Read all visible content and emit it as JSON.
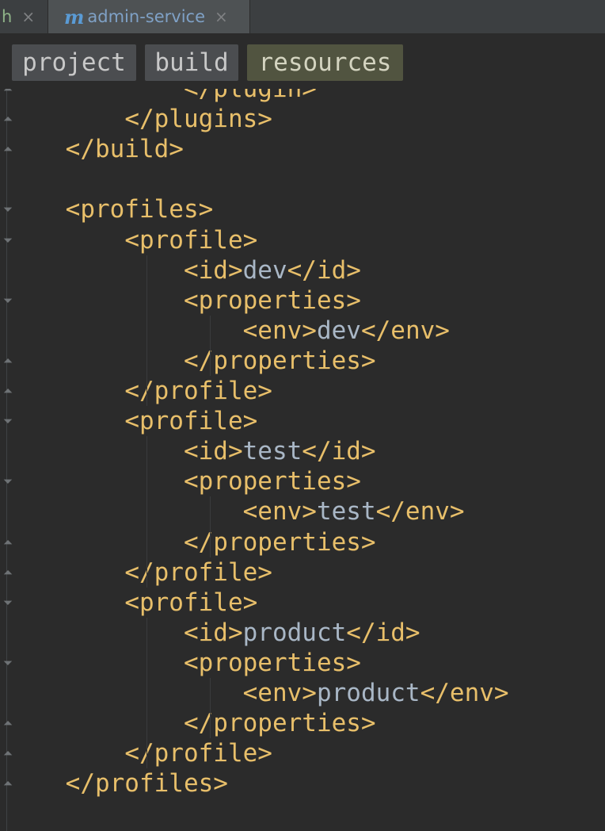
{
  "tabs": [
    {
      "label": "h",
      "icon": "",
      "close": "×"
    },
    {
      "label": "admin-service",
      "icon": "m",
      "close": "×"
    }
  ],
  "breadcrumbs": [
    "project",
    "build",
    "resources"
  ],
  "code": [
    "            </plugin>",
    "        </plugins>",
    "    </build>",
    "",
    "    <profiles>",
    "        <profile>",
    "            <id>dev</id>",
    "            <properties>",
    "                <env>dev</env>",
    "            </properties>",
    "        </profile>",
    "        <profile>",
    "            <id>test</id>",
    "            <properties>",
    "                <env>test</env>",
    "            </properties>",
    "        </profile>",
    "        <profile>",
    "            <id>product</id>",
    "            <properties>",
    "                <env>product</env>",
    "            </properties>",
    "        </profile>",
    "    </profiles>"
  ],
  "colors": {
    "tag": "#e8bf6a",
    "value": "#a9b7c6",
    "background": "#2b2b2b"
  }
}
